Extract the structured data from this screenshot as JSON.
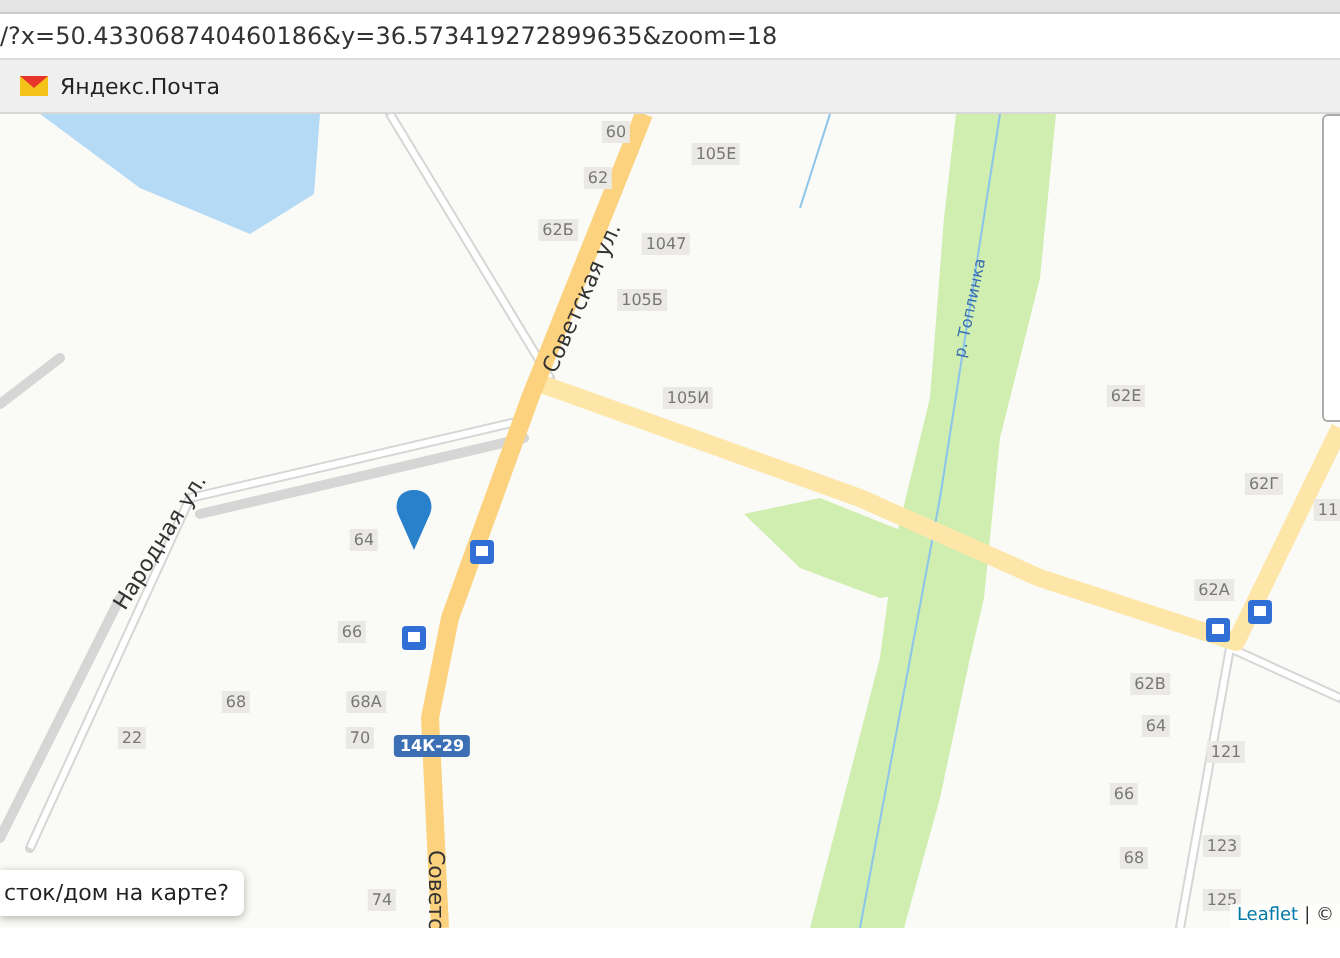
{
  "browser": {
    "address": "/?x=50.433068740460186&y=36.573419272899635&zoom=18",
    "bookmarks": [
      {
        "label": "Яндекс.Почта"
      }
    ]
  },
  "map": {
    "streets": [
      {
        "name": "Советская ул."
      },
      {
        "name": "Народная ул."
      },
      {
        "name": "р. Топлинка"
      },
      {
        "name": "Советс"
      }
    ],
    "house_numbers": [
      "60",
      "105Е",
      "62",
      "62Б",
      "1047",
      "105Б",
      "105И",
      "62Е",
      "62Г",
      "11",
      "64",
      "62А",
      "66",
      "62В",
      "68",
      "68А",
      "64",
      "22",
      "70",
      "121",
      "66",
      "123",
      "68",
      "74",
      "125"
    ],
    "road_number": "14К-29",
    "popup": {
      "text": "сток/дом на карте?"
    },
    "attribution": {
      "link": "Leaflet",
      "text": "| ©"
    }
  }
}
